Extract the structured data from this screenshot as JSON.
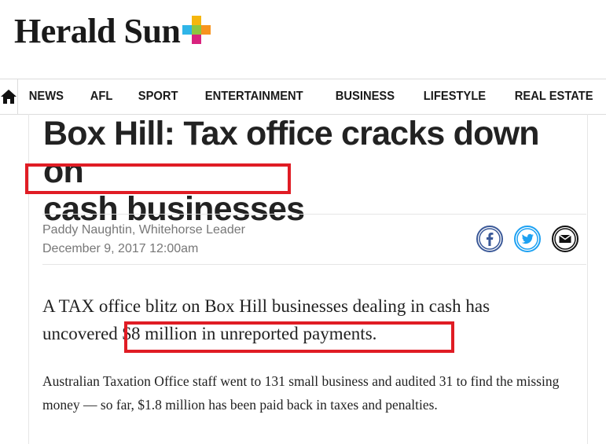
{
  "header": {
    "logo_text": "Herald Sun",
    "logo_plus_colors": [
      "#f5b60e",
      "#2fb5e8",
      "#8dc63f",
      "#f7941e",
      "#d9237e"
    ]
  },
  "nav": {
    "home_icon": "home-icon",
    "items": [
      "NEWS",
      "AFL",
      "SPORT",
      "ENTERTAINMENT",
      "BUSINESS",
      "LIFESTYLE",
      "REAL ESTATE"
    ]
  },
  "article": {
    "headline_line1": "Box Hill: Tax office cracks down on",
    "headline_line2": "cash businesses",
    "author": "Paddy Naughtin, Whitehorse Leader",
    "date": "December 9, 2017 12:00am",
    "standfirst_line1": "A TAX office blitz on Box Hill businesses dealing in cash has",
    "standfirst_line2": "uncovered $8 million in unreported payments.",
    "body": "Australian Taxation Office staff went to 131 small business and audited 31 to find the missing money — so far, $1.8 million has been paid back in taxes and penalties."
  },
  "social": {
    "facebook_icon": "facebook-icon",
    "twitter_icon": "twitter-icon",
    "email_icon": "email-icon",
    "facebook_color": "#3b5998",
    "twitter_color": "#1da1f2"
  },
  "annotations": {
    "highlight_color": "#e01c24"
  }
}
